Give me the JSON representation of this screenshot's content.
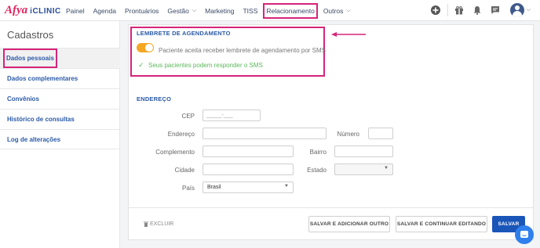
{
  "brand": {
    "name_part1": "Afya",
    "name_part2": "iCLINIC"
  },
  "nav": {
    "items": [
      "Painel",
      "Agenda",
      "Prontuários",
      "Gestão",
      "Marketing",
      "TISS",
      "Relacionamento",
      "Outros"
    ],
    "active": "Relacionamento",
    "dropdown_items": [
      "Gestão",
      "Outros"
    ]
  },
  "sidebar": {
    "title": "Cadastros",
    "items": [
      "Dados pessoais",
      "Dados complementares",
      "Convênios",
      "Histórico de consultas",
      "Log de alterações"
    ],
    "selected": "Dados pessoais"
  },
  "reminder": {
    "section_title": "LEMBRETE DE AGENDAMENTO",
    "toggle_label": "Paciente aceita receber lembrete de agendamento por SMS",
    "toggle_on": true,
    "confirm_text": "Seus pacientes podem responder o SMS"
  },
  "address": {
    "section_title": "ENDEREÇO",
    "cep_label": "CEP",
    "cep_placeholder": "_____-___",
    "endereco_label": "Endereço",
    "numero_label": "Número",
    "complemento_label": "Complemento",
    "bairro_label": "Bairro",
    "cidade_label": "Cidade",
    "estado_label": "Estado",
    "pais_label": "País",
    "pais_value": "Brasil"
  },
  "footer": {
    "delete_label": "EXCLUIR",
    "save_add_label": "SALVAR E ADICIONAR OUTRO",
    "save_continue_label": "SALVAR E CONTINUAR EDITANDO",
    "save_label": "SALVAR"
  },
  "colors": {
    "accent": "#1a56b8",
    "highlight": "#d6247a",
    "toggle": "#f5a623",
    "success": "#5cb85c"
  }
}
